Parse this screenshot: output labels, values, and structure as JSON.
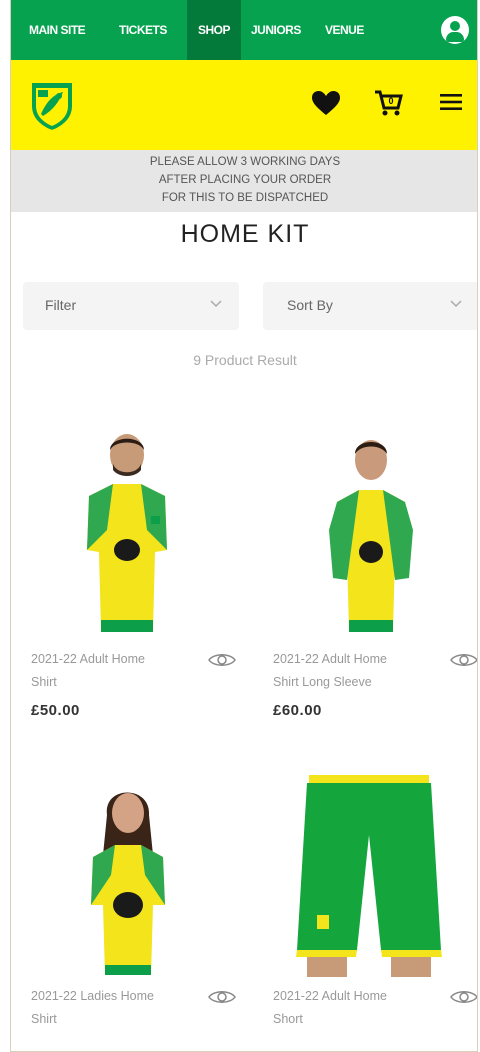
{
  "topnav": {
    "items": [
      "MAIN SITE",
      "TICKETS",
      "SHOP",
      "JUNIORS",
      "VENUE"
    ],
    "active": "SHOP",
    "color": "#06a24f"
  },
  "header": {
    "bg": "#fff200",
    "icons": [
      "crest-logo",
      "heart-icon",
      "cart-icon",
      "menu-icon"
    ],
    "cart_count": "0"
  },
  "notice": {
    "lines": [
      "PLEASE ALLOW 3 WORKING DAYS",
      "AFTER PLACING YOUR ORDER",
      "FOR THIS TO BE DISPATCHED"
    ]
  },
  "page": {
    "title": "HOME KIT",
    "filter_label": "Filter",
    "sort_label": "Sort By",
    "result_text": "9 Product Result"
  },
  "products": [
    {
      "name_line1": "2021-22 Adult Home",
      "name_line2": "Shirt",
      "price": "£50.00"
    },
    {
      "name_line1": "2021-22 Adult Home",
      "name_line2": "Shirt Long Sleeve",
      "price": "£60.00"
    },
    {
      "name_line1": "2021-22 Ladies Home",
      "name_line2": "Shirt",
      "price": ""
    },
    {
      "name_line1": "2021-22 Adult Home",
      "name_line2": "Short",
      "price": ""
    }
  ]
}
